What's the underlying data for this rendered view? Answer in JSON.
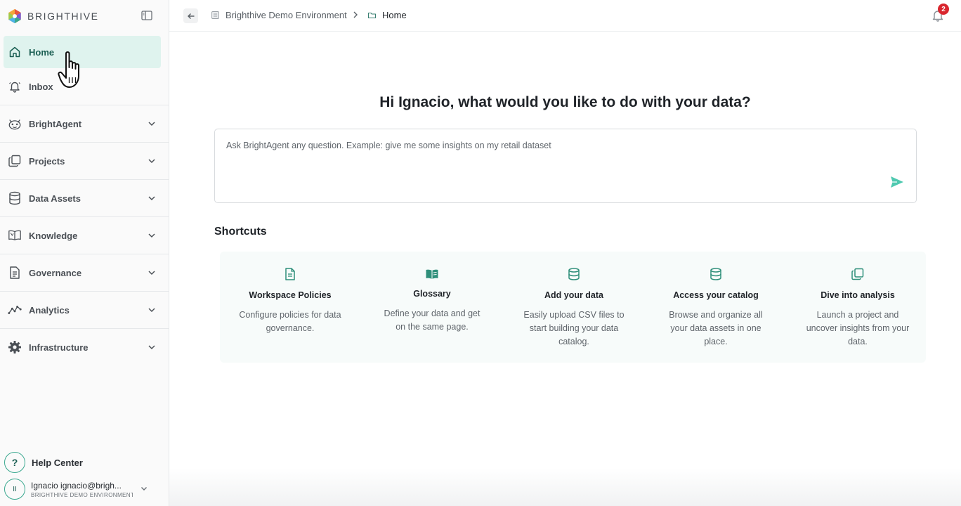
{
  "brand": {
    "name": "BRIGHTHIVE",
    "logo_icon": "brighthive-logo"
  },
  "sidebar": {
    "items": [
      {
        "label": "Home",
        "icon": "home-icon",
        "active": true,
        "expandable": false
      },
      {
        "label": "Inbox",
        "icon": "bell-icon",
        "active": false,
        "expandable": false
      },
      {
        "label": "BrightAgent",
        "icon": "agent-icon",
        "active": false,
        "expandable": true
      },
      {
        "label": "Projects",
        "icon": "projects-icon",
        "active": false,
        "expandable": true
      },
      {
        "label": "Data Assets",
        "icon": "database-icon",
        "active": false,
        "expandable": true
      },
      {
        "label": "Knowledge",
        "icon": "book-icon",
        "active": false,
        "expandable": true
      },
      {
        "label": "Governance",
        "icon": "document-icon",
        "active": false,
        "expandable": true
      },
      {
        "label": "Analytics",
        "icon": "analytics-icon",
        "active": false,
        "expandable": true
      },
      {
        "label": "Infrastructure",
        "icon": "gear-icon",
        "active": false,
        "expandable": true
      }
    ],
    "help": {
      "label": "Help Center",
      "glyph": "?"
    },
    "user": {
      "initials": "II",
      "name": "Ignacio ignacio@brigh...",
      "org": "BRIGHTHIVE DEMO ENVIRONMENT"
    }
  },
  "topbar": {
    "breadcrumb": [
      {
        "label": "Brighthive Demo Environment",
        "icon": "workspace-icon"
      },
      {
        "label": "Home",
        "icon": "folder-icon"
      }
    ],
    "notifications": {
      "count": "2"
    }
  },
  "main": {
    "greeting": "Hi Ignacio, what would you like to do with your data?",
    "prompt_placeholder": "Ask BrightAgent any question. Example: give me some insights on my retail dataset",
    "shortcuts_title": "Shortcuts",
    "shortcuts": [
      {
        "title": "Workspace Policies",
        "description": "Configure policies for data governance.",
        "icon": "document-icon"
      },
      {
        "title": "Glossary",
        "description": "Define your data and get on the same page.",
        "icon": "open-book-icon"
      },
      {
        "title": "Add your data",
        "description": "Easily upload CSV files to start building your data catalog.",
        "icon": "database-icon"
      },
      {
        "title": "Access your catalog",
        "description": "Browse and organize all your data assets in one place.",
        "icon": "database-icon"
      },
      {
        "title": "Dive into analysis",
        "description": "Launch a project and uncover insights from your data.",
        "icon": "projects-icon"
      }
    ]
  },
  "colors": {
    "accent": "#3aa88f",
    "active_bg": "#dff3ee",
    "badge": "#d9262e"
  }
}
